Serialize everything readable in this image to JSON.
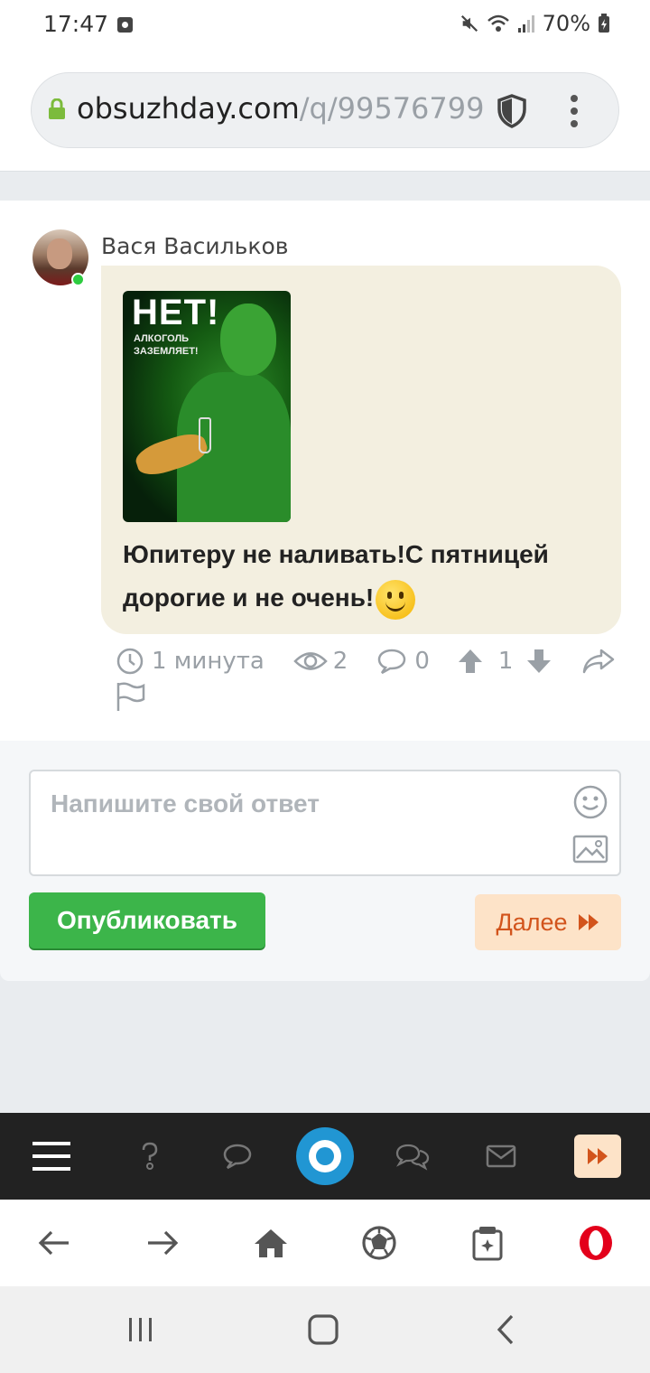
{
  "status_bar": {
    "time": "17:47",
    "battery": "70%"
  },
  "url_bar": {
    "domain": "obsuzhday.com",
    "path": "/q/99576799"
  },
  "post": {
    "author": "Вася Васильков",
    "image": {
      "title": "НЕТ!",
      "subtitle": "АЛКОГОЛЬ ЗАЗЕМЛЯЕТ!"
    },
    "text": "Юпитеру не наливать!С пятницей дорогие и не очень!",
    "meta": {
      "time": "1 минута",
      "views": "2",
      "comments": "0",
      "rating": "1"
    }
  },
  "reply": {
    "placeholder": "Напишите свой ответ",
    "publish_label": "Опубликовать",
    "next_label": "Далее"
  },
  "colors": {
    "accent_green": "#3cb54a",
    "next_bg": "#fde3c8",
    "next_text": "#d2541c",
    "logo_blue": "#2196d3",
    "opera_red": "#e3001b"
  }
}
